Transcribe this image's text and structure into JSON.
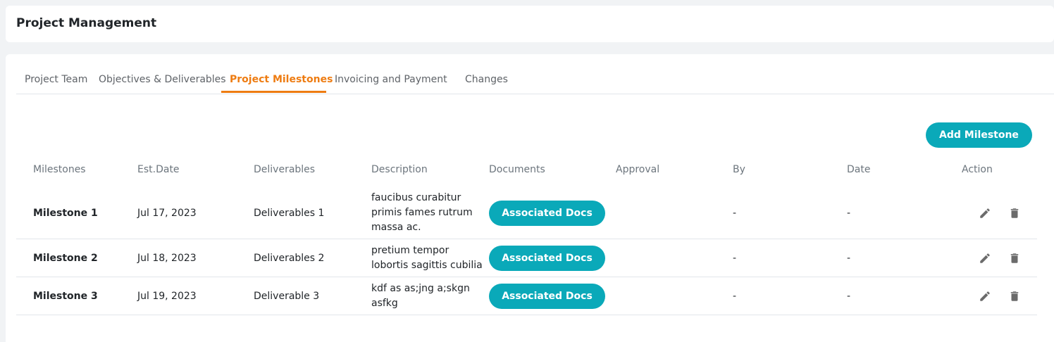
{
  "header": {
    "title": "Project Management"
  },
  "tabs": [
    {
      "label": "Project Team"
    },
    {
      "label": "Objectives & Deliverables"
    },
    {
      "label": "Project Milestones"
    },
    {
      "label": "Invoicing and Payment"
    },
    {
      "label": "Changes"
    }
  ],
  "active_tab": "Project Milestones",
  "toolbar": {
    "add_label": "Add Milestone"
  },
  "table": {
    "columns": [
      "Milestones",
      "Est.Date",
      "Deliverables",
      "Description",
      "Documents",
      "Approval",
      "By",
      "Date",
      "Action"
    ],
    "rows": [
      {
        "milestone": "Milestone 1",
        "est_date": "Jul 17, 2023",
        "deliverables": "Deliverables 1",
        "description": "faucibus curabitur primis fames rutrum massa ac.",
        "documents": "Associated Docs",
        "approval": "",
        "by": "-",
        "date": "-"
      },
      {
        "milestone": "Milestone 2",
        "est_date": "Jul 18, 2023",
        "deliverables": "Deliverables 2",
        "description": "pretium tempor lobortis sagittis cubilia",
        "documents": "Associated Docs",
        "approval": "",
        "by": "-",
        "date": "-"
      },
      {
        "milestone": "Milestone 3",
        "est_date": "Jul 19, 2023",
        "deliverables": "Deliverable 3",
        "description": "kdf as as;jng a;skgn asfkg",
        "documents": "Associated Docs",
        "approval": "",
        "by": "-",
        "date": "-"
      }
    ]
  },
  "icons": {
    "edit": "pencil-icon",
    "delete": "trash-icon"
  },
  "colors": {
    "accent": "#ee7c12",
    "primary_button": "#0aa9b9",
    "background": "#f1f3f5"
  }
}
